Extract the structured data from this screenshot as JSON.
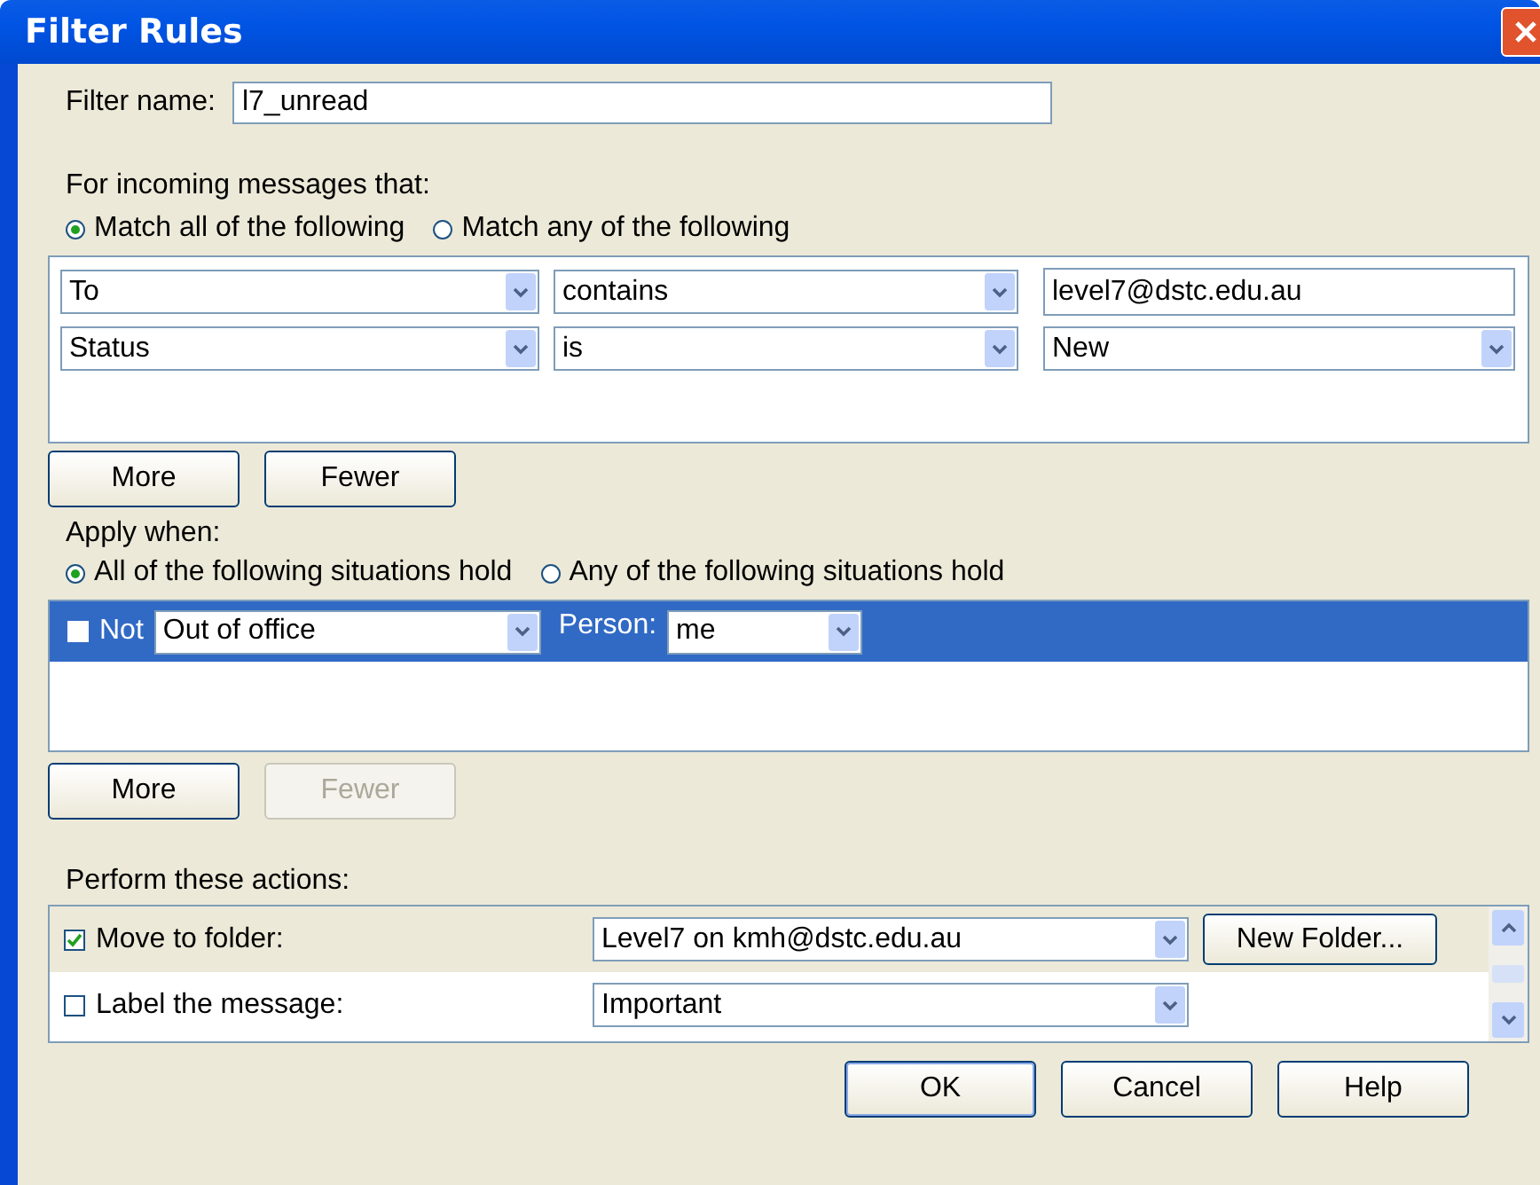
{
  "window": {
    "title": "Filter Rules"
  },
  "filter_name": {
    "label": "Filter name:",
    "value": "l7_unread"
  },
  "criteria": {
    "heading": "For incoming messages that:",
    "options": [
      {
        "label": "Match all of the following",
        "selected": true
      },
      {
        "label": "Match any of the following",
        "selected": false
      }
    ],
    "rows": [
      {
        "field": "To",
        "operator": "contains",
        "value": "level7@dstc.edu.au",
        "kind": "text"
      },
      {
        "field": "Status",
        "operator": "is",
        "value": "New",
        "kind": "dropdown"
      }
    ],
    "buttons": [
      {
        "label": "More",
        "disabled": false
      },
      {
        "label": "Fewer",
        "disabled": false
      }
    ]
  },
  "conditions": {
    "heading": "Apply when:",
    "options": [
      {
        "label": "All of the following situations hold",
        "selected": true
      },
      {
        "label": "Any of the following situations hold",
        "selected": false
      }
    ],
    "rows": [
      {
        "not_label": "Not",
        "negated": false,
        "situation": "Out of office",
        "person_label": "Person:",
        "person": "me",
        "selected": true
      }
    ],
    "buttons": [
      {
        "label": "More",
        "disabled": false
      },
      {
        "label": "Fewer",
        "disabled": true
      }
    ]
  },
  "actions": {
    "heading": "Perform these actions:",
    "rows": [
      {
        "label": "Move to folder:",
        "checked": true,
        "target": "Level7 on kmh@dstc.edu.au",
        "button": "New Folder...",
        "selected": true
      },
      {
        "label": "Label the message:",
        "checked": false,
        "target": "Important",
        "selected": false
      }
    ]
  },
  "buttons": [
    {
      "label": "OK",
      "default": true
    },
    {
      "label": "Cancel",
      "default": false
    },
    {
      "label": "Help",
      "default": false
    }
  ]
}
